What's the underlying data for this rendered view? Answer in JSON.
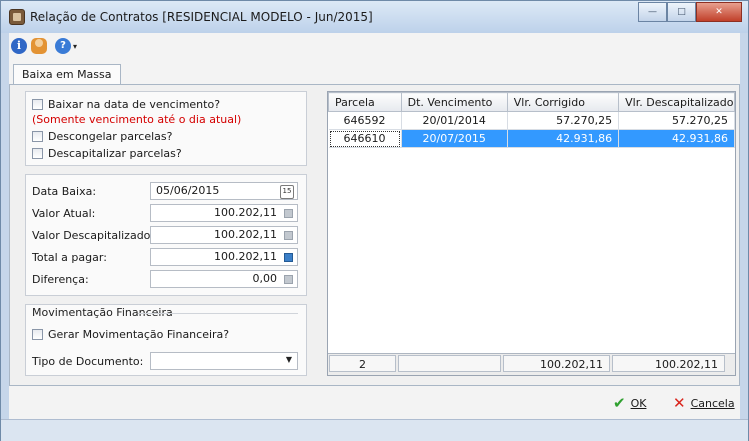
{
  "window": {
    "title": "Relação de Contratos [RESIDENCIAL MODELO - Jun/2015]"
  },
  "toolbar": {
    "info_glyph": "i",
    "help_glyph": "?",
    "dropdown_glyph": "▾"
  },
  "tabs": [
    {
      "label": "Baixa em Massa"
    }
  ],
  "options": {
    "baixar_label": "Baixar na data de vencimento?",
    "warning": "(Somente vencimento até o dia atual)",
    "descongelar_label": "Descongelar parcelas?",
    "descapitalizar_label": "Descapitalizar parcelas?"
  },
  "fields": {
    "data_baixa": {
      "label": "Data Baixa:",
      "value": "05/06/2015"
    },
    "valor_atual": {
      "label": "Valor Atual:",
      "value": "100.202,11"
    },
    "valor_descapitalizado": {
      "label": "Valor Descapitalizado:",
      "value": "100.202,11"
    },
    "total_pagar": {
      "label": "Total a pagar:",
      "value": "100.202,11"
    },
    "diferenca": {
      "label": "Diferença:",
      "value": "0,00"
    }
  },
  "movimentacao": {
    "group_title": "Movimentação Financeira",
    "gerar_label": "Gerar Movimentação Financeira?",
    "tipo_documento_label": "Tipo de Documento:",
    "tipo_documento_value": ""
  },
  "grid": {
    "columns": [
      "Parcela",
      "Dt. Vencimento",
      "Vlr. Corrigido",
      "Vlr. Descapitalizado"
    ],
    "rows": [
      {
        "parcela": "646592",
        "vencimento": "20/01/2014",
        "corrigido": "57.270,25",
        "descapitalizado": "57.270,25",
        "selected": false
      },
      {
        "parcela": "646610",
        "vencimento": "20/07/2015",
        "corrigido": "42.931,86",
        "descapitalizado": "42.931,86",
        "selected": true
      }
    ],
    "footer": {
      "count": "2",
      "blank": "",
      "total_corrigido": "100.202,11",
      "total_descapitalizado": "100.202,11"
    }
  },
  "buttons": {
    "ok": "OK",
    "cancel": "Cancela"
  },
  "window_buttons": {
    "minimize": "—",
    "maximize": "□",
    "close": "✕"
  }
}
